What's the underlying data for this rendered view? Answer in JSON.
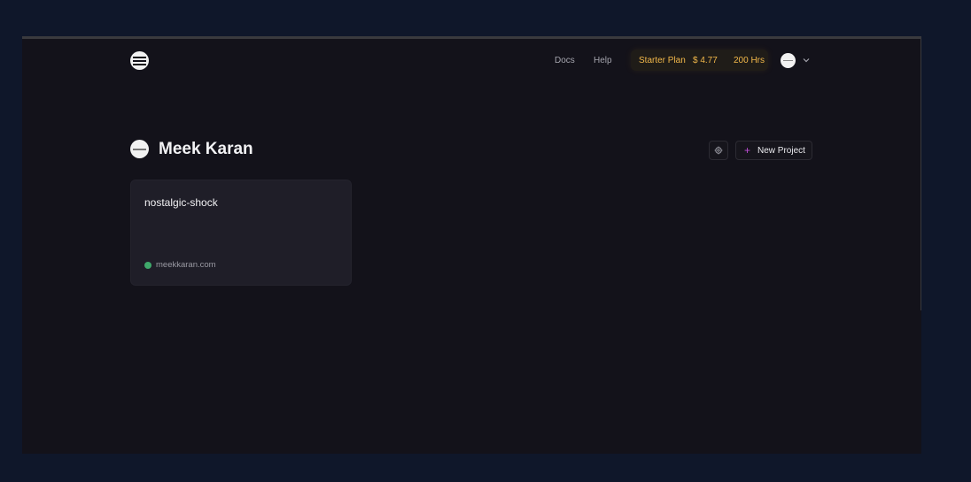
{
  "header": {
    "nav": {
      "docs": "Docs",
      "help": "Help"
    },
    "plan": {
      "name": "Starter Plan",
      "credit": "$ 4.77",
      "hours": "200 Hrs"
    }
  },
  "team": {
    "name": "Meek Karan"
  },
  "actions": {
    "new_project": "New Project"
  },
  "projects": [
    {
      "name": "nostalgic-shock",
      "domain": "meekkaran.com",
      "status_color": "#3fa96b"
    }
  ],
  "icons": {
    "logo": "app-logo",
    "settings": "gear-icon",
    "plus": "plus-icon",
    "chevron": "chevron-down-icon",
    "avatar": "user-avatar"
  },
  "colors": {
    "background": "#0f172a",
    "panel": "#13121a",
    "card": "#1f1e28",
    "plan_text": "#f2b84a",
    "accent": "#c04fd9",
    "status_online": "#3fa96b"
  }
}
